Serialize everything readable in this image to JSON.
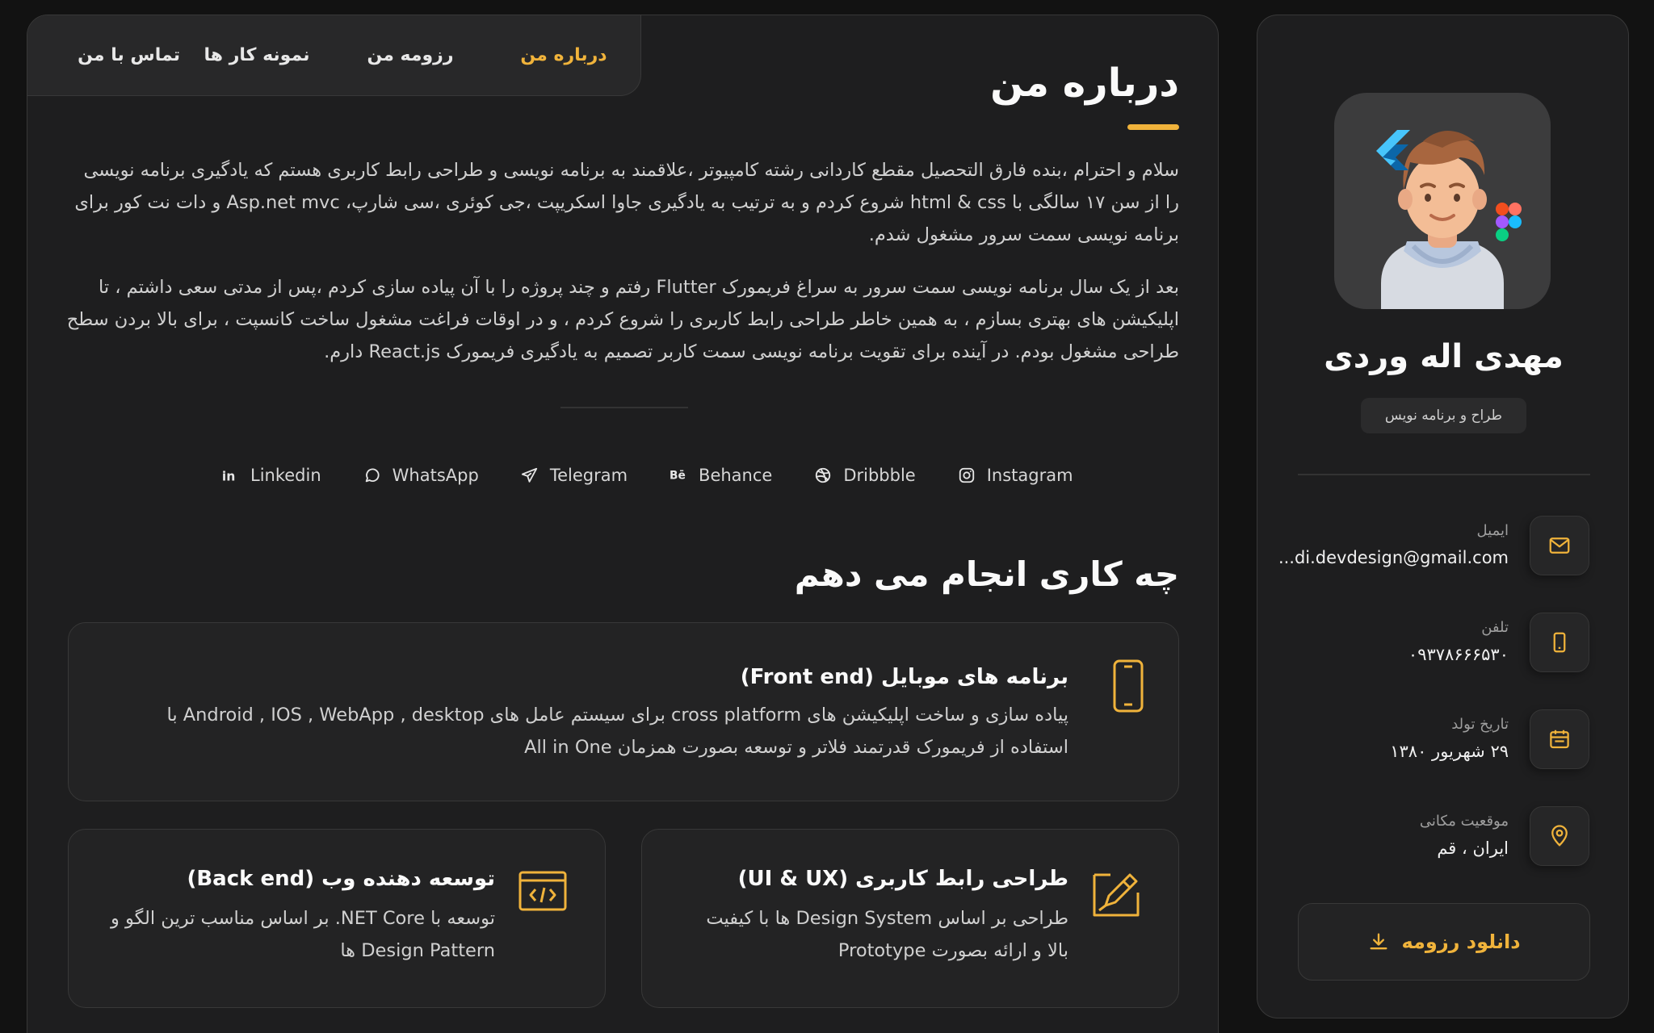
{
  "nav": {
    "items": [
      {
        "label": "درباره من"
      },
      {
        "label": "رزومه من"
      },
      {
        "label": "نمونه کار ها"
      },
      {
        "label": "تماس با من"
      }
    ]
  },
  "about": {
    "title": "درباره من",
    "paragraph1": "سلام و احترام ،بنده فارق التحصیل مقطع کاردانی رشته کامپیوتر ،علاقمند به برنامه نویسی و طراحی رابط کاربری هستم که یادگیری برنامه نویسی را از سن ۱۷ سالگی با html & css شروع کردم و به ترتیب به یادگیری جاوا اسکریپت ،جی کوئری ،سی شارپ، Asp.net mvc و دات نت کور برای برنامه نویسی سمت سرور مشغول شدم.",
    "paragraph2": "بعد از یک سال برنامه نویسی سمت سرور به سراغ فریمورک Flutter رفتم و چند پروژه را با آن پیاده سازی کردم ،پس از مدتی سعی داشتم ، تا اپلیکیشن های بهتری بسازم ، به همین خاطر طراحی رابط کاربری را شروع کردم ، و در اوقات فراغت مشغول ساخت کانسپت ، برای بالا بردن سطح طراحی مشغول بودم. در آینده برای تقویت برنامه نویسی سمت کاربر تصمیم به یادگیری فریمورک React.js دارم."
  },
  "socials": [
    {
      "label": "Linkedin",
      "icon": "linkedin-icon"
    },
    {
      "label": "WhatsApp",
      "icon": "whatsapp-icon"
    },
    {
      "label": "Telegram",
      "icon": "telegram-icon"
    },
    {
      "label": "Behance",
      "icon": "behance-icon"
    },
    {
      "label": "Dribbble",
      "icon": "dribbble-icon"
    },
    {
      "label": "Instagram",
      "icon": "instagram-icon"
    }
  ],
  "services": {
    "title": "چه کاری انجام می دهم",
    "items": [
      {
        "title": "برنامه های موبایل (Front end)",
        "text": "پیاده سازی و ساخت اپلیکیشن های cross platform برای سیستم عامل های Android , IOS , WebApp , desktop با استفاده از فریمورک قدرتمند فلاتر و توسعه بصورت همزمان All in One",
        "icon": "mobile-phone-icon"
      },
      {
        "title": "طراحی رابط کاربری (UI & UX)",
        "text": "طراحی بر اساس Design System ها با کیفیت بالا و ارائه بصورت Prototype",
        "icon": "design-pen-icon"
      },
      {
        "title": "توسعه دهنده وب (Back end)",
        "text": "توسعه با NET Core. بر اساس مناسب ترین الگو و Design Pattern ها",
        "icon": "code-window-icon"
      }
    ]
  },
  "profile": {
    "name": "مهدی اله وردی",
    "role": "طراح و برنامه نویس",
    "info": [
      {
        "label": "ایمیل",
        "value": "...di.devdesign@gmail.com",
        "icon": "mail-icon"
      },
      {
        "label": "تلفن",
        "value": "۰۹۳۷۸۶۶۶۵۳۰",
        "icon": "phone-icon"
      },
      {
        "label": "تاریخ تولد",
        "value": "۲۹ شهریور ۱۳۸۰",
        "icon": "calendar-icon"
      },
      {
        "label": "موقعیت مکانی",
        "value": "ایران ، قم",
        "icon": "location-pin-icon"
      }
    ],
    "download_label": "دانلود رزومه"
  },
  "colors": {
    "accent": "#f0b33b",
    "background": "#121212",
    "panel": "#1e1e1f",
    "card": "#232324"
  }
}
